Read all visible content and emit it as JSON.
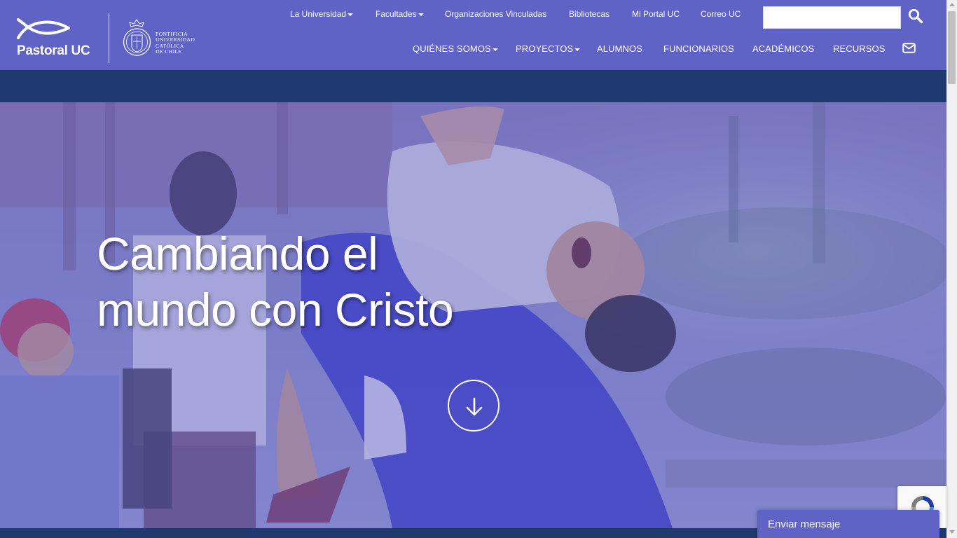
{
  "brand": {
    "name": "Pastoral UC",
    "university_lines": [
      "Pontificia",
      "Universidad",
      "Católica",
      "de Chile"
    ]
  },
  "top_links": [
    {
      "label": "La Universidad",
      "dropdown": true
    },
    {
      "label": "Facultades",
      "dropdown": true
    },
    {
      "label": "Organizaciones Vinculadas",
      "dropdown": false
    },
    {
      "label": "Bibliotecas",
      "dropdown": false
    },
    {
      "label": "Mi Portal UC",
      "dropdown": false
    },
    {
      "label": "Correo UC",
      "dropdown": false
    }
  ],
  "search": {
    "placeholder": "",
    "value": ""
  },
  "main_nav": [
    {
      "label": "QUIÉNES SOMOS",
      "dropdown": true
    },
    {
      "label": "PROYECTOS",
      "dropdown": true
    },
    {
      "label": "ALUMNOS",
      "dropdown": false
    },
    {
      "label": "FUNCIONARIOS",
      "dropdown": false
    },
    {
      "label": "ACADÉMICOS",
      "dropdown": false
    },
    {
      "label": "RECURSOS",
      "dropdown": false
    }
  ],
  "hero": {
    "title_line1": "Cambiando el",
    "title_line2": "mundo con Cristo"
  },
  "chat": {
    "label": "Enviar mensaje"
  },
  "icons": {
    "search": "search-icon",
    "mail": "mail-icon",
    "scroll_down": "arrow-down-icon",
    "recaptcha": "recaptcha-icon"
  },
  "colors": {
    "header": "#5f63c6",
    "strip": "#1f3a6e",
    "white": "#ffffff"
  }
}
